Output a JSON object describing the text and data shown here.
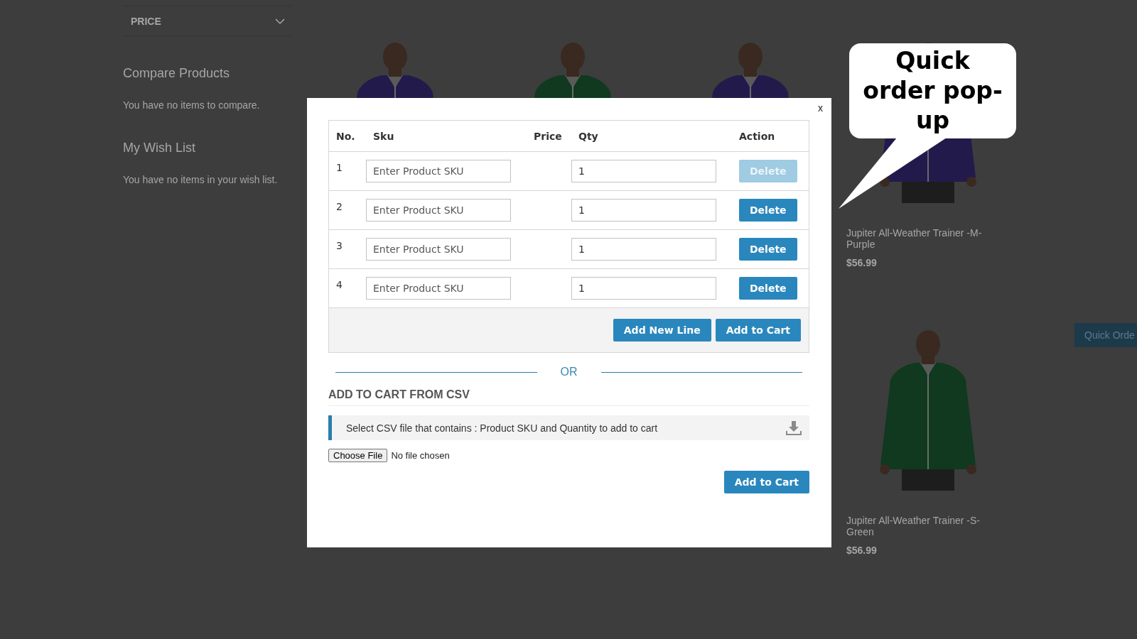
{
  "sidebar": {
    "filter": {
      "label": "PRICE",
      "expanded": false
    },
    "sections": [
      {
        "title": "Compare Products",
        "text": "You have no items to compare."
      },
      {
        "title": "My Wish List",
        "text": "You have no items in your wish list."
      }
    ]
  },
  "products": [
    {
      "kind": "picture"
    },
    {
      "kind": "picture"
    },
    {
      "kind": "picture"
    },
    {
      "kind": "picture",
      "name": "Jupiter All-Weather Trainer -M-Purple",
      "price": "$56.99"
    },
    {
      "kind": "picture",
      "name": "Jupiter All-Weather Trainer -S-Green",
      "price": "$56.99"
    }
  ],
  "quick_order_tab": "Quick Orde",
  "modal": {
    "close": "x",
    "table": {
      "columns": [
        "No.",
        "Sku",
        "Price",
        "Qty",
        "Action"
      ],
      "rows": [
        {
          "no": "1",
          "sku_placeholder": "Enter Product SKU",
          "qty": "1",
          "action": {
            "label": "Delete",
            "disabled": true
          }
        },
        {
          "no": "2",
          "sku_placeholder": "Enter Product SKU",
          "qty": "1",
          "action": {
            "label": "Delete",
            "disabled": false
          }
        },
        {
          "no": "3",
          "sku_placeholder": "Enter Product SKU",
          "qty": "1",
          "action": {
            "label": "Delete",
            "disabled": false
          }
        },
        {
          "no": "4",
          "sku_placeholder": "Enter Product SKU",
          "qty": "1",
          "action": {
            "label": "Delete",
            "disabled": false
          }
        }
      ],
      "footer_buttons": [
        "Add New Line",
        "Add to Cart"
      ]
    },
    "divider": "OR",
    "csv": {
      "heading": "ADD TO CART FROM CSV",
      "note": "Select CSV file that contains : Product SKU and Quantity to add to cart",
      "file_button": "Choose File",
      "file_status": "No file chosen",
      "submit": "Add to Cart"
    }
  },
  "callout": "Quick order pop-up"
}
